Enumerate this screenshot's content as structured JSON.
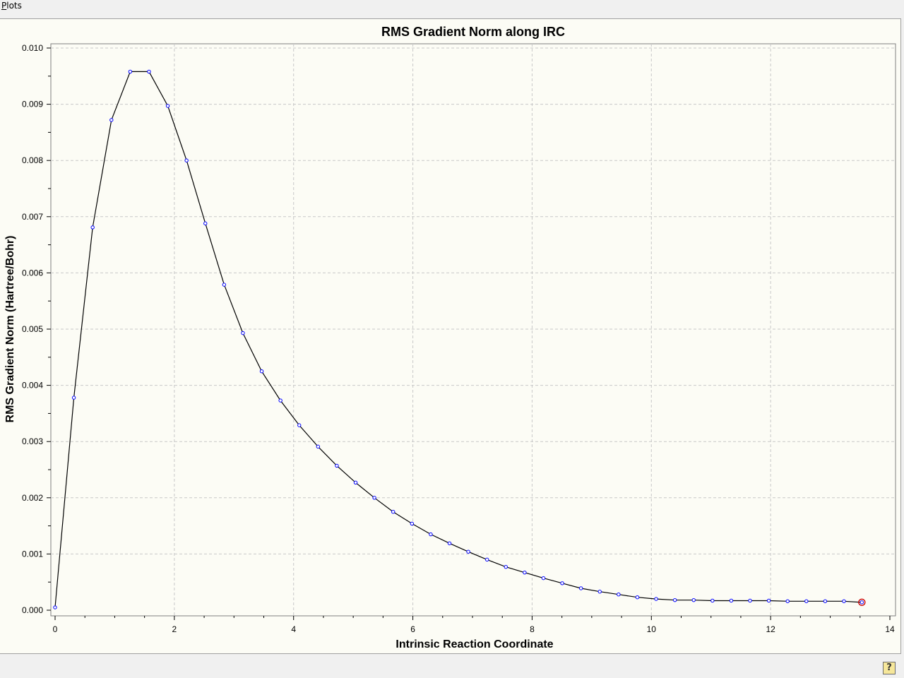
{
  "menu": {
    "plots_label": "Plots",
    "plots_mnemonic": "P",
    "plots_rest": "lots"
  },
  "help_button": {
    "label": "?",
    "icon": "help-icon"
  },
  "colors": {
    "plot_background": "#fcfcf5",
    "line": "#000000",
    "marker": "#0000ff",
    "highlight_marker": "#cc0000",
    "grid": "#c8c8c8"
  },
  "chart_data": {
    "type": "line",
    "title": "RMS Gradient Norm along IRC",
    "xlabel": "Intrinsic Reaction Coordinate",
    "ylabel": "RMS Gradient Norm (Hartree/Bohr)",
    "xlim": [
      0,
      14
    ],
    "ylim": [
      0,
      0.01
    ],
    "xticks": [
      "0",
      "2",
      "4",
      "6",
      "8",
      "10",
      "12",
      "14"
    ],
    "yticks": [
      "0.000",
      "0.001",
      "0.002",
      "0.003",
      "0.004",
      "0.005",
      "0.006",
      "0.007",
      "0.008",
      "0.009",
      "0.010"
    ],
    "grid": true,
    "legend": "none",
    "highlighted_point_index": 43,
    "series": [
      {
        "x": [
          0.0,
          0.315,
          0.63,
          0.945,
          1.26,
          1.575,
          1.89,
          2.205,
          2.52,
          2.835,
          3.15,
          3.465,
          3.78,
          4.095,
          4.41,
          4.725,
          5.04,
          5.355,
          5.67,
          5.985,
          6.3,
          6.615,
          6.93,
          7.245,
          7.56,
          7.875,
          8.19,
          8.505,
          8.82,
          9.135,
          9.45,
          9.765,
          10.08,
          10.395,
          10.71,
          11.025,
          11.34,
          11.655,
          11.97,
          12.285,
          12.6,
          12.915,
          13.23,
          13.53
        ],
        "y": [
          5e-05,
          0.00378,
          0.00681,
          0.00872,
          0.00958,
          0.00958,
          0.00897,
          0.008,
          0.00688,
          0.00579,
          0.00493,
          0.00425,
          0.00373,
          0.00329,
          0.00291,
          0.00257,
          0.00227,
          0.002,
          0.00175,
          0.00154,
          0.00135,
          0.00119,
          0.00104,
          0.0009,
          0.00077,
          0.00067,
          0.00057,
          0.00048,
          0.00039,
          0.00033,
          0.00028,
          0.00023,
          0.0002,
          0.00018,
          0.00018,
          0.00017,
          0.00017,
          0.00017,
          0.00017,
          0.00016,
          0.00016,
          0.00016,
          0.00016,
          0.00014
        ]
      }
    ]
  }
}
